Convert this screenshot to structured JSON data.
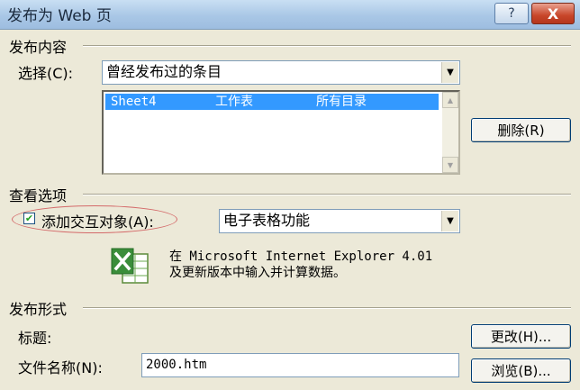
{
  "window": {
    "title": "发布为 Web 页",
    "help_glyph": "?",
    "close_glyph": "X"
  },
  "publish_content": {
    "section_title": "发布内容",
    "choose_label": "选择",
    "choose_shortcut": "(C):",
    "choose_value": "曾经发布过的条目",
    "list_items": [
      {
        "name": "Sheet4",
        "type": "工作表",
        "scope": "所有目录",
        "selected": true
      }
    ],
    "delete_button": "删除(R)"
  },
  "view_options": {
    "section_title": "查看选项",
    "interactive_checkbox_label": "添加交互对象(A):",
    "interactive_checked": true,
    "function_value": "电子表格功能",
    "icon": "excel-icon",
    "description_line1": "在 Microsoft Internet Explorer 4.01",
    "description_line2": "及更新版本中输入并计算数据。"
  },
  "publish_format": {
    "section_title": "发布形式",
    "title_label": "标题:",
    "change_button": "更改(H)...",
    "filename_label": "文件名称(N):",
    "filename_value": "2000.htm",
    "browse_button": "浏览(B)..."
  },
  "colors": {
    "selection": "#3399ff",
    "dialog_bg": "#ece9d8",
    "annotation_oval": "#d46a6a"
  }
}
